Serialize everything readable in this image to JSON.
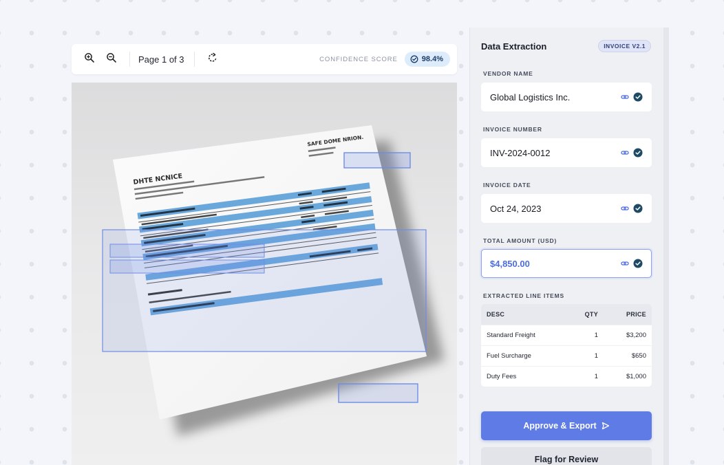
{
  "viewer": {
    "page_indicator": "Page 1 of 3",
    "confidence_label": "CONFIDENCE SCORE",
    "confidence_value": "98.4%",
    "icons": [
      "zoom-in-icon",
      "zoom-out-icon",
      "rotate-icon",
      "check-circle-icon"
    ]
  },
  "panel": {
    "title": "Data Extraction",
    "version_badge": "INVOICE V2.1",
    "fields": [
      {
        "label": "VENDOR NAME",
        "value": "Global Logistics Inc."
      },
      {
        "label": "INVOICE NUMBER",
        "value": "INV-2024-0012"
      },
      {
        "label": "INVOICE DATE",
        "value": "Oct 24, 2023"
      },
      {
        "label": "TOTAL AMOUNT (USD)",
        "value": "$4,850.00"
      }
    ],
    "line_items": {
      "label": "EXTRACTED LINE ITEMS",
      "headers": {
        "desc": "DESC",
        "qty": "QTY",
        "price": "PRICE"
      },
      "rows": [
        {
          "desc": "Standard Freight",
          "qty": "1",
          "price": "$3,200"
        },
        {
          "desc": "Fuel Surcharge",
          "qty": "1",
          "price": "$650"
        },
        {
          "desc": "Duty Fees",
          "qty": "1",
          "price": "$1,000"
        }
      ]
    },
    "approve_label": "Approve & Export",
    "flag_label": "Flag for Review"
  },
  "colors": {
    "accent": "#5f7be6",
    "verified": "#1f4a66",
    "highlight": "#7fb2e0"
  }
}
